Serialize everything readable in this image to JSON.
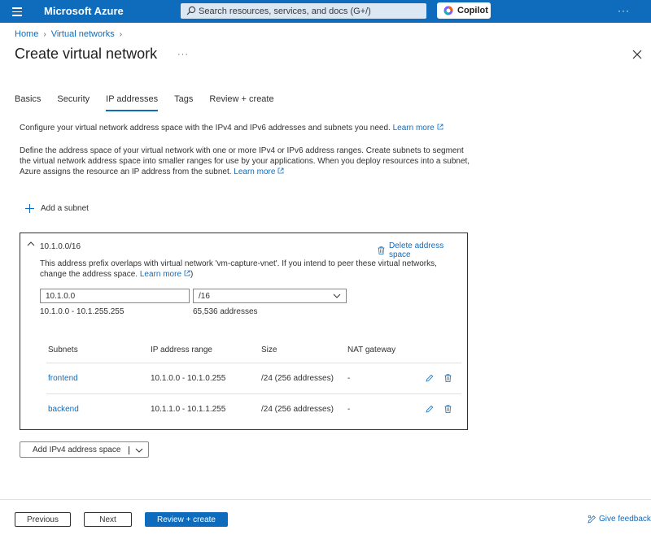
{
  "topbar": {
    "brand": "Microsoft Azure",
    "search_placeholder": "Search resources, services, and docs (G+/)",
    "copilot_label": "Copilot",
    "more": "···",
    "bar_color": "#0f6cbd"
  },
  "breadcrumb": {
    "items": [
      "Home",
      "Virtual networks"
    ]
  },
  "page": {
    "title": "Create virtual network",
    "more": "···"
  },
  "tabs": [
    {
      "label": "Basics",
      "active": false
    },
    {
      "label": "Security",
      "active": false
    },
    {
      "label": "IP addresses",
      "active": true
    },
    {
      "label": "Tags",
      "active": false
    },
    {
      "label": "Review + create",
      "active": false
    }
  ],
  "intro": {
    "line1": "Configure your virtual network address space with the IPv4 and IPv6 addresses and subnets you need.",
    "line1_link": "Learn more",
    "line2": "Define the address space of your virtual network with one or more IPv4 or IPv6 address ranges. Create subnets to segment the virtual network address space into smaller ranges for use by your applications. When you deploy resources into a subnet, Azure assigns the resource an IP address from the subnet.",
    "line2_link": "Learn more"
  },
  "add_subnet_label": "Add a subnet",
  "address_space": {
    "prefix": "10.1.0.0/16",
    "delete_label": "Delete address space",
    "warning": "This address prefix overlaps with virtual network 'vm-capture-vnet'. If you intend to peer these virtual networks, change the address space.",
    "warning_link": "Learn more",
    "warning_close": ")",
    "address_value": "10.1.0.0",
    "mask_value": "/16",
    "range": "10.1.0.0 - 10.1.255.255",
    "count": "65,536 addresses",
    "subnets": {
      "headers": [
        "Subnets",
        "IP address range",
        "Size",
        "NAT gateway"
      ],
      "rows": [
        {
          "name": "frontend",
          "range": "10.1.0.0 - 10.1.0.255",
          "size": "/24 (256 addresses)",
          "nat": "-"
        },
        {
          "name": "backend",
          "range": "10.1.1.0 - 10.1.1.255",
          "size": "/24 (256 addresses)",
          "nat": "-"
        }
      ]
    }
  },
  "add_ipv4_label": "Add IPv4 address space",
  "footer": {
    "previous": "Previous",
    "next": "Next",
    "review": "Review + create",
    "feedback": "Give feedback"
  },
  "icons": {
    "hamburger": "hamburger-icon",
    "search": "search-icon",
    "copilot": "copilot-icon",
    "close": "close-icon",
    "external": "external-link-icon",
    "plus": "plus-icon",
    "trash": "trash-icon",
    "edit": "pencil-icon",
    "chevron": "chevron-down-icon",
    "feedback": "feedback-icon"
  }
}
